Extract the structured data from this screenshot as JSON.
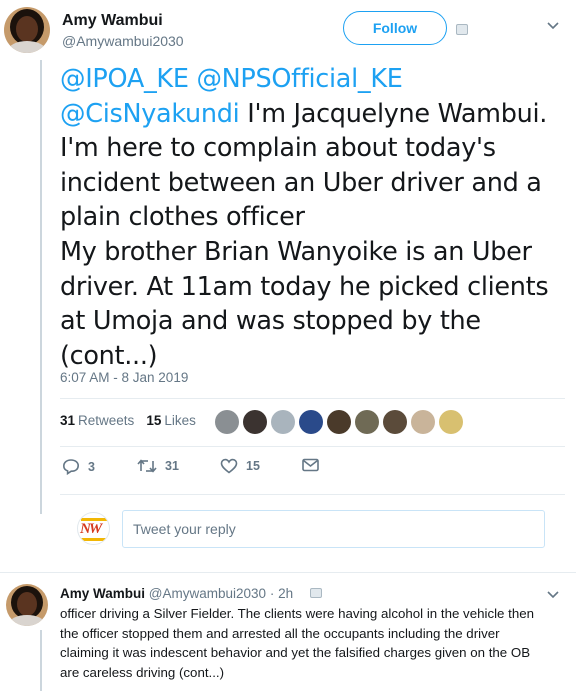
{
  "tweet": {
    "author_name": "Amy Wambui",
    "author_handle": "@Amywambui2030",
    "follow_label": "Follow",
    "text_lines": [
      {
        "mentions": "@IPOA_KE @NPSOfficial_KE",
        "text": ""
      },
      {
        "mentions": "@CisNyakundi",
        "text": " I'm Jacquelyne Wambui."
      },
      {
        "mentions": "",
        "text": "I'm here to complain about today's"
      },
      {
        "mentions": "",
        "text": "incident between an Uber driver and a"
      },
      {
        "mentions": "",
        "text": "plain clothes officer"
      },
      {
        "mentions": "",
        "text": "My brother Brian Wanyoike is an Uber"
      },
      {
        "mentions": "",
        "text": "driver. At 11am today he picked clients"
      },
      {
        "mentions": "",
        "text": "at Umoja and was stopped by the"
      },
      {
        "mentions": "",
        "text": "(cont...)"
      }
    ],
    "timestamp": "6:07 AM - 8 Jan 2019",
    "stats": {
      "retweets_count": "31",
      "retweets_label": "Retweets",
      "likes_count": "15",
      "likes_label": "Likes"
    },
    "liker_colors": [
      "#8a8f93",
      "#3b3330",
      "#a9b4bd",
      "#2a4a8a",
      "#4a3a2a",
      "#6f6a55",
      "#5b4b3a",
      "#c9b49a",
      "#d8c070"
    ],
    "actions": {
      "reply_count": "3",
      "retweet_count": "31",
      "like_count": "15"
    },
    "reply_placeholder": "Tweet your reply"
  },
  "reply_tweet": {
    "author_name": "Amy Wambui",
    "author_handle": "@Amywambui2030",
    "time_ago": "2h",
    "lines": [
      "officer driving a Silver Fielder. The clients were having alcohol in the  vehicle then",
      "the officer stopped them and arrested all the occupants including the driver",
      "claiming it was indescent behavior and yet the falsified charges given on the OB",
      "are careless driving (cont...)"
    ]
  },
  "colors": {
    "accent": "#1da1f2",
    "muted": "#657786",
    "text": "#14171a"
  }
}
